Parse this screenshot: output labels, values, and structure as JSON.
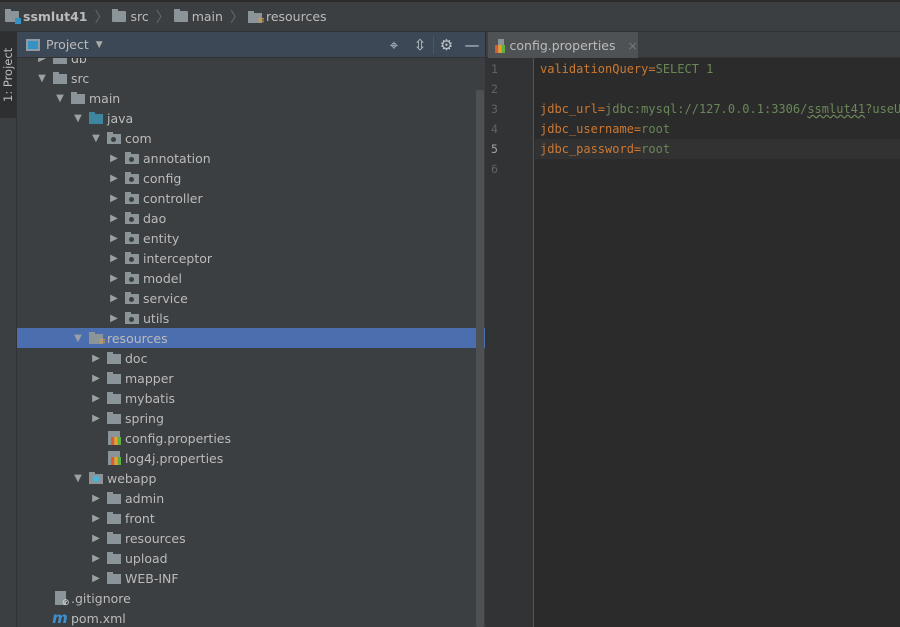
{
  "breadcrumb": [
    {
      "label": "ssmlut41",
      "icon": "module-folder-icon"
    },
    {
      "label": "src",
      "icon": "folder-icon"
    },
    {
      "label": "main",
      "icon": "folder-icon"
    },
    {
      "label": "resources",
      "icon": "resources-folder-icon"
    }
  ],
  "tool_strip": {
    "project_tab": "1: Project"
  },
  "project_panel": {
    "title": "Project",
    "actions": [
      "locate-icon",
      "collapse-all-icon",
      "gear-icon",
      "minimize-icon"
    ],
    "tree": [
      {
        "label": "db",
        "level": 0,
        "arrow": "collapsed",
        "icon": "folder"
      },
      {
        "label": "src",
        "level": 0,
        "arrow": "expanded",
        "icon": "folder"
      },
      {
        "label": "main",
        "level": 1,
        "arrow": "expanded",
        "icon": "folder"
      },
      {
        "label": "java",
        "level": 2,
        "arrow": "expanded",
        "icon": "source-folder"
      },
      {
        "label": "com",
        "level": 3,
        "arrow": "expanded",
        "icon": "package"
      },
      {
        "label": "annotation",
        "level": 4,
        "arrow": "collapsed",
        "icon": "package"
      },
      {
        "label": "config",
        "level": 4,
        "arrow": "collapsed",
        "icon": "package"
      },
      {
        "label": "controller",
        "level": 4,
        "arrow": "collapsed",
        "icon": "package"
      },
      {
        "label": "dao",
        "level": 4,
        "arrow": "collapsed",
        "icon": "package"
      },
      {
        "label": "entity",
        "level": 4,
        "arrow": "collapsed",
        "icon": "package"
      },
      {
        "label": "interceptor",
        "level": 4,
        "arrow": "collapsed",
        "icon": "package"
      },
      {
        "label": "model",
        "level": 4,
        "arrow": "collapsed",
        "icon": "package"
      },
      {
        "label": "service",
        "level": 4,
        "arrow": "collapsed",
        "icon": "package"
      },
      {
        "label": "utils",
        "level": 4,
        "arrow": "collapsed",
        "icon": "package"
      },
      {
        "label": "resources",
        "level": 2,
        "arrow": "expanded",
        "icon": "resources",
        "selected": true
      },
      {
        "label": "doc",
        "level": 3,
        "arrow": "collapsed",
        "icon": "folder"
      },
      {
        "label": "mapper",
        "level": 3,
        "arrow": "collapsed",
        "icon": "folder"
      },
      {
        "label": "mybatis",
        "level": 3,
        "arrow": "collapsed",
        "icon": "folder"
      },
      {
        "label": "spring",
        "level": 3,
        "arrow": "collapsed",
        "icon": "folder"
      },
      {
        "label": "config.properties",
        "level": 3,
        "arrow": "none",
        "icon": "properties"
      },
      {
        "label": "log4j.properties",
        "level": 3,
        "arrow": "none",
        "icon": "properties"
      },
      {
        "label": "webapp",
        "level": 2,
        "arrow": "expanded",
        "icon": "web"
      },
      {
        "label": "admin",
        "level": 3,
        "arrow": "collapsed",
        "icon": "folder"
      },
      {
        "label": "front",
        "level": 3,
        "arrow": "collapsed",
        "icon": "folder"
      },
      {
        "label": "resources",
        "level": 3,
        "arrow": "collapsed",
        "icon": "folder"
      },
      {
        "label": "upload",
        "level": 3,
        "arrow": "collapsed",
        "icon": "folder"
      },
      {
        "label": "WEB-INF",
        "level": 3,
        "arrow": "collapsed",
        "icon": "folder"
      },
      {
        "label": ".gitignore",
        "level": 0,
        "arrow": "none",
        "icon": "gitignore"
      },
      {
        "label": "pom.xml",
        "level": 0,
        "arrow": "none",
        "icon": "maven"
      }
    ]
  },
  "editor": {
    "tab": {
      "label": "config.properties",
      "close": "×"
    },
    "current_line": 5,
    "lines": [
      {
        "n": "1",
        "key": "validationQuery",
        "eq": "=",
        "val": "SELECT 1"
      },
      {
        "n": "2",
        "key": "",
        "eq": "",
        "val": ""
      },
      {
        "n": "3",
        "key": "jdbc_url",
        "eq": "=",
        "val": "jdbc:mysql://127.0.0.1:3306/",
        "squig": "ssmlut41",
        "rest": "?useUnicode"
      },
      {
        "n": "4",
        "key": "jdbc_username",
        "eq": "=",
        "val": "root"
      },
      {
        "n": "5",
        "key": "jdbc_password",
        "eq": "=",
        "val": "root"
      },
      {
        "n": "6",
        "key": "",
        "eq": "",
        "val": ""
      }
    ]
  }
}
